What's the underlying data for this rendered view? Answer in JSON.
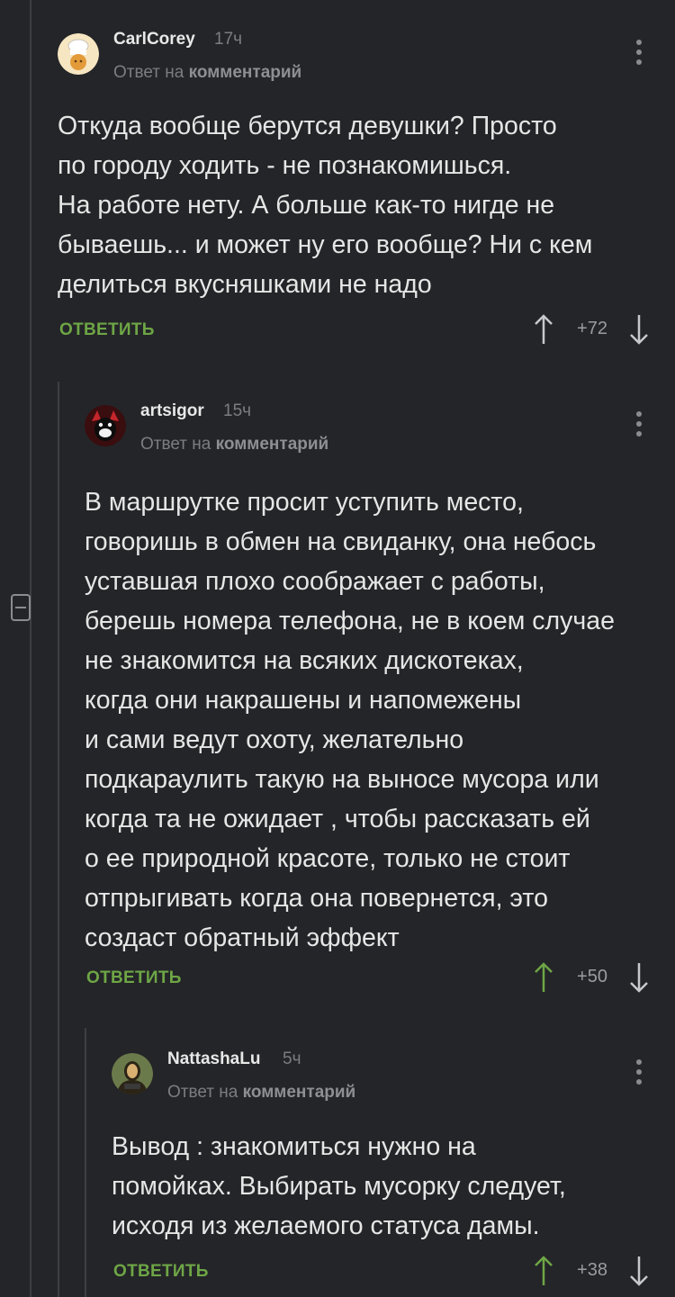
{
  "comments": [
    {
      "username": "CarlCorey",
      "time": "17ч",
      "reply_prefix": "Ответ на",
      "reply_target": "комментарий",
      "text": "Откуда вообще берутся девушки? Просто\nпо городу ходить - не познакомишься.\nНа работе нету. А больше как-то нигде не\nбываешь... и может ну его вообще? Ни с кем\nделиться вкусняшками не надо",
      "reply_label": "ОТВЕТИТЬ",
      "score": "+72",
      "upvoted": false
    },
    {
      "username": "artsigor",
      "time": "15ч",
      "reply_prefix": "Ответ на",
      "reply_target": "комментарий",
      "text": "В маршрутке просит уступить место,\nговоришь в обмен на свиданку, она небось\nуставшая плохо соображает с работы,\nберешь номера телефона, не в коем случае\nне  знакомится на всяких дискотеках,\nкогда они накрашены и напомежены\nи сами ведут охоту, желательно\nподкараулить такую на выносе мусора или\nкогда та не ожидает  , чтобы рассказать ей\nо ее природной красоте,  только не стоит\nотпрыгивать когда она повернется, это\nсоздаст обратный эффект",
      "reply_label": "ОТВЕТИТЬ",
      "score": "+50",
      "upvoted": true
    },
    {
      "username": "NattashaLu",
      "time": "5ч",
      "reply_prefix": "Ответ на",
      "reply_target": "комментарий",
      "text": "Вывод : знакомиться нужно на\nпомойках. Выбирать мусорку следует,\nисходя из желаемого статуса дамы.",
      "reply_label": "ОТВЕТИТЬ",
      "score": "+38",
      "upvoted": true
    }
  ],
  "colors": {
    "background": "#242528",
    "accent_green": "#6ea646",
    "muted": "#7b7d81",
    "thread_line": "#3d3f43"
  },
  "icons": [
    "chef-avatar-icon",
    "mask-avatar-icon",
    "mona-lisa-avatar-icon",
    "kebab-menu-icon",
    "arrow-up-icon",
    "arrow-down-icon",
    "collapse-icon"
  ]
}
